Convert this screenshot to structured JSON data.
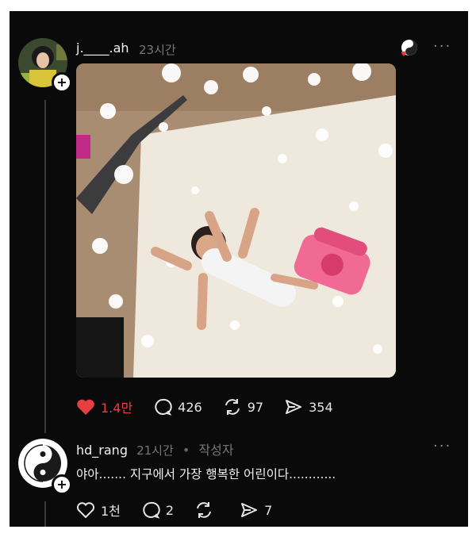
{
  "post": {
    "username": "j.____.ah",
    "time": "23시간",
    "more": "···",
    "stats": {
      "likes": "1.4만",
      "comments": "426",
      "reposts": "97",
      "shares": "354"
    }
  },
  "reply": {
    "username": "hd_rang",
    "time": "21시간",
    "badge": "작성자",
    "text": "야아....... 지구에서 가장 행복한 어린이다............",
    "more": "···",
    "stats": {
      "likes": "1천",
      "comments": "2",
      "reposts": "",
      "shares": "7"
    }
  },
  "colors": {
    "background": "#0a0a0a",
    "like_active": "#e5403f",
    "text": "#f3f3f3",
    "muted": "#777777"
  },
  "icons": [
    "plus-icon",
    "heart-icon",
    "comment-icon",
    "repost-icon",
    "share-icon",
    "more-icon",
    "yin-yang-icon"
  ]
}
